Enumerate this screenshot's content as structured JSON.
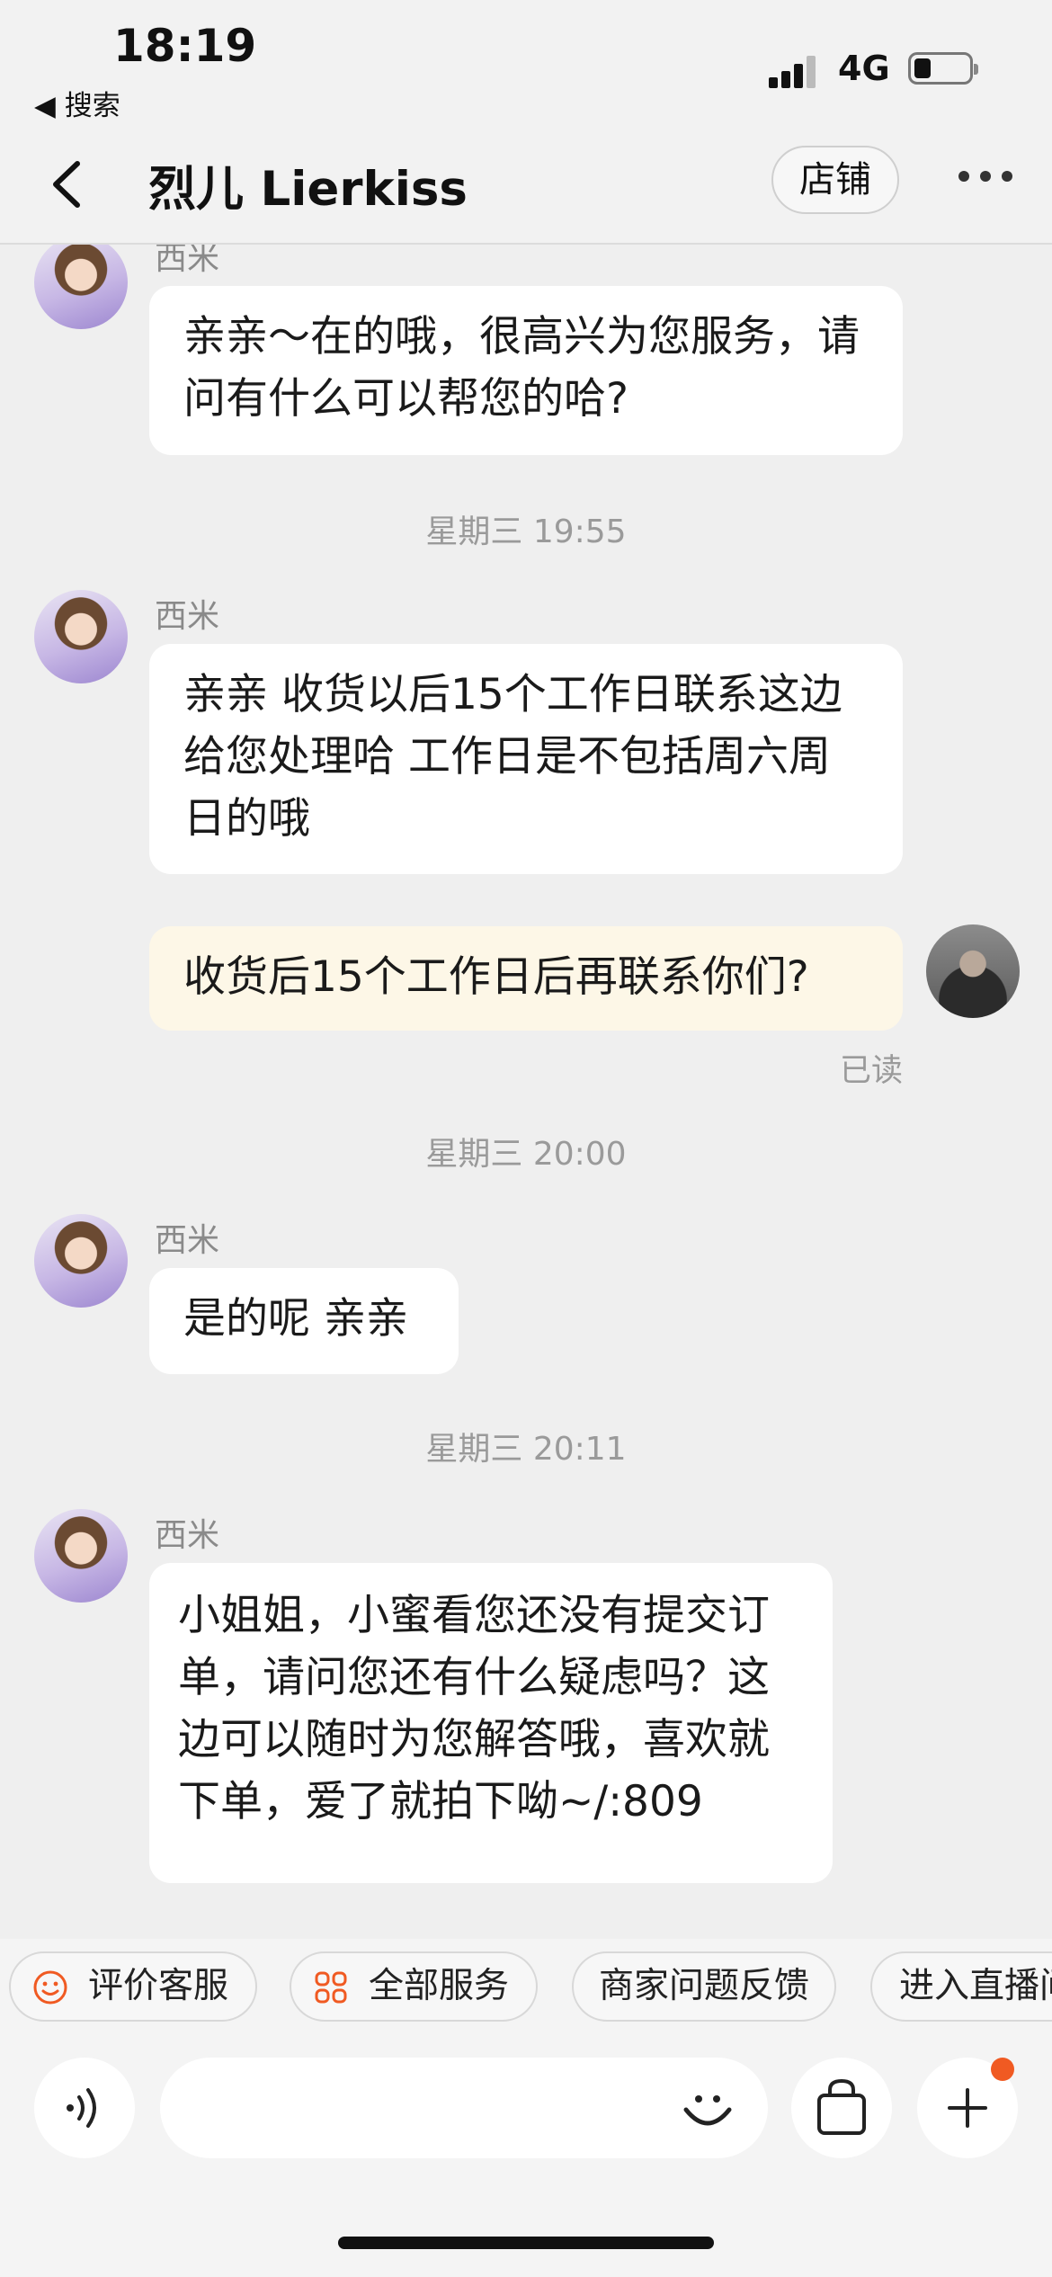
{
  "status_bar": {
    "time": "18:19",
    "back_app": "◀ 搜索",
    "network": "4G"
  },
  "nav": {
    "title": "烈儿 Lierkiss",
    "shop_label": "店铺"
  },
  "messages": [
    {
      "sender": "西米",
      "text": "亲亲～在的哦，很高兴为您服务，请问有什么可以帮您的哈?"
    },
    {
      "timestamp": "星期三 19:55"
    },
    {
      "sender": "西米",
      "text": "亲亲 收货以后15个工作日联系这边给您处理哈  工作日是不包括周六周日的哦"
    },
    {
      "sender": "me",
      "text": "收货后15个工作日后再联系你们?",
      "status": "已读"
    },
    {
      "timestamp": "星期三 20:00"
    },
    {
      "sender": "西米",
      "text": "是的呢 亲亲"
    },
    {
      "timestamp": "星期三 20:11"
    },
    {
      "sender": "西米",
      "text": "小姐姐，小蜜看您还没有提交订单，请问您还有什么疑虑吗？这边可以随时为您解答哦，喜欢就下单，爱了就拍下呦~/:809"
    }
  ],
  "quick_actions": [
    "评价客服",
    "全部服务",
    "商家问题反馈",
    "进入直播间"
  ],
  "icons": [
    "signal-icon",
    "battery-icon",
    "back-arrow-icon",
    "more-icon",
    "smiley-icon",
    "grid-icon",
    "voice-icon",
    "emoji-icon",
    "shopping-bag-icon",
    "plus-icon"
  ],
  "colors": {
    "accent_orange": "#f05a22",
    "my_bubble": "#fdf7e7",
    "agent_bubble": "#ffffff",
    "background": "#efefef"
  }
}
